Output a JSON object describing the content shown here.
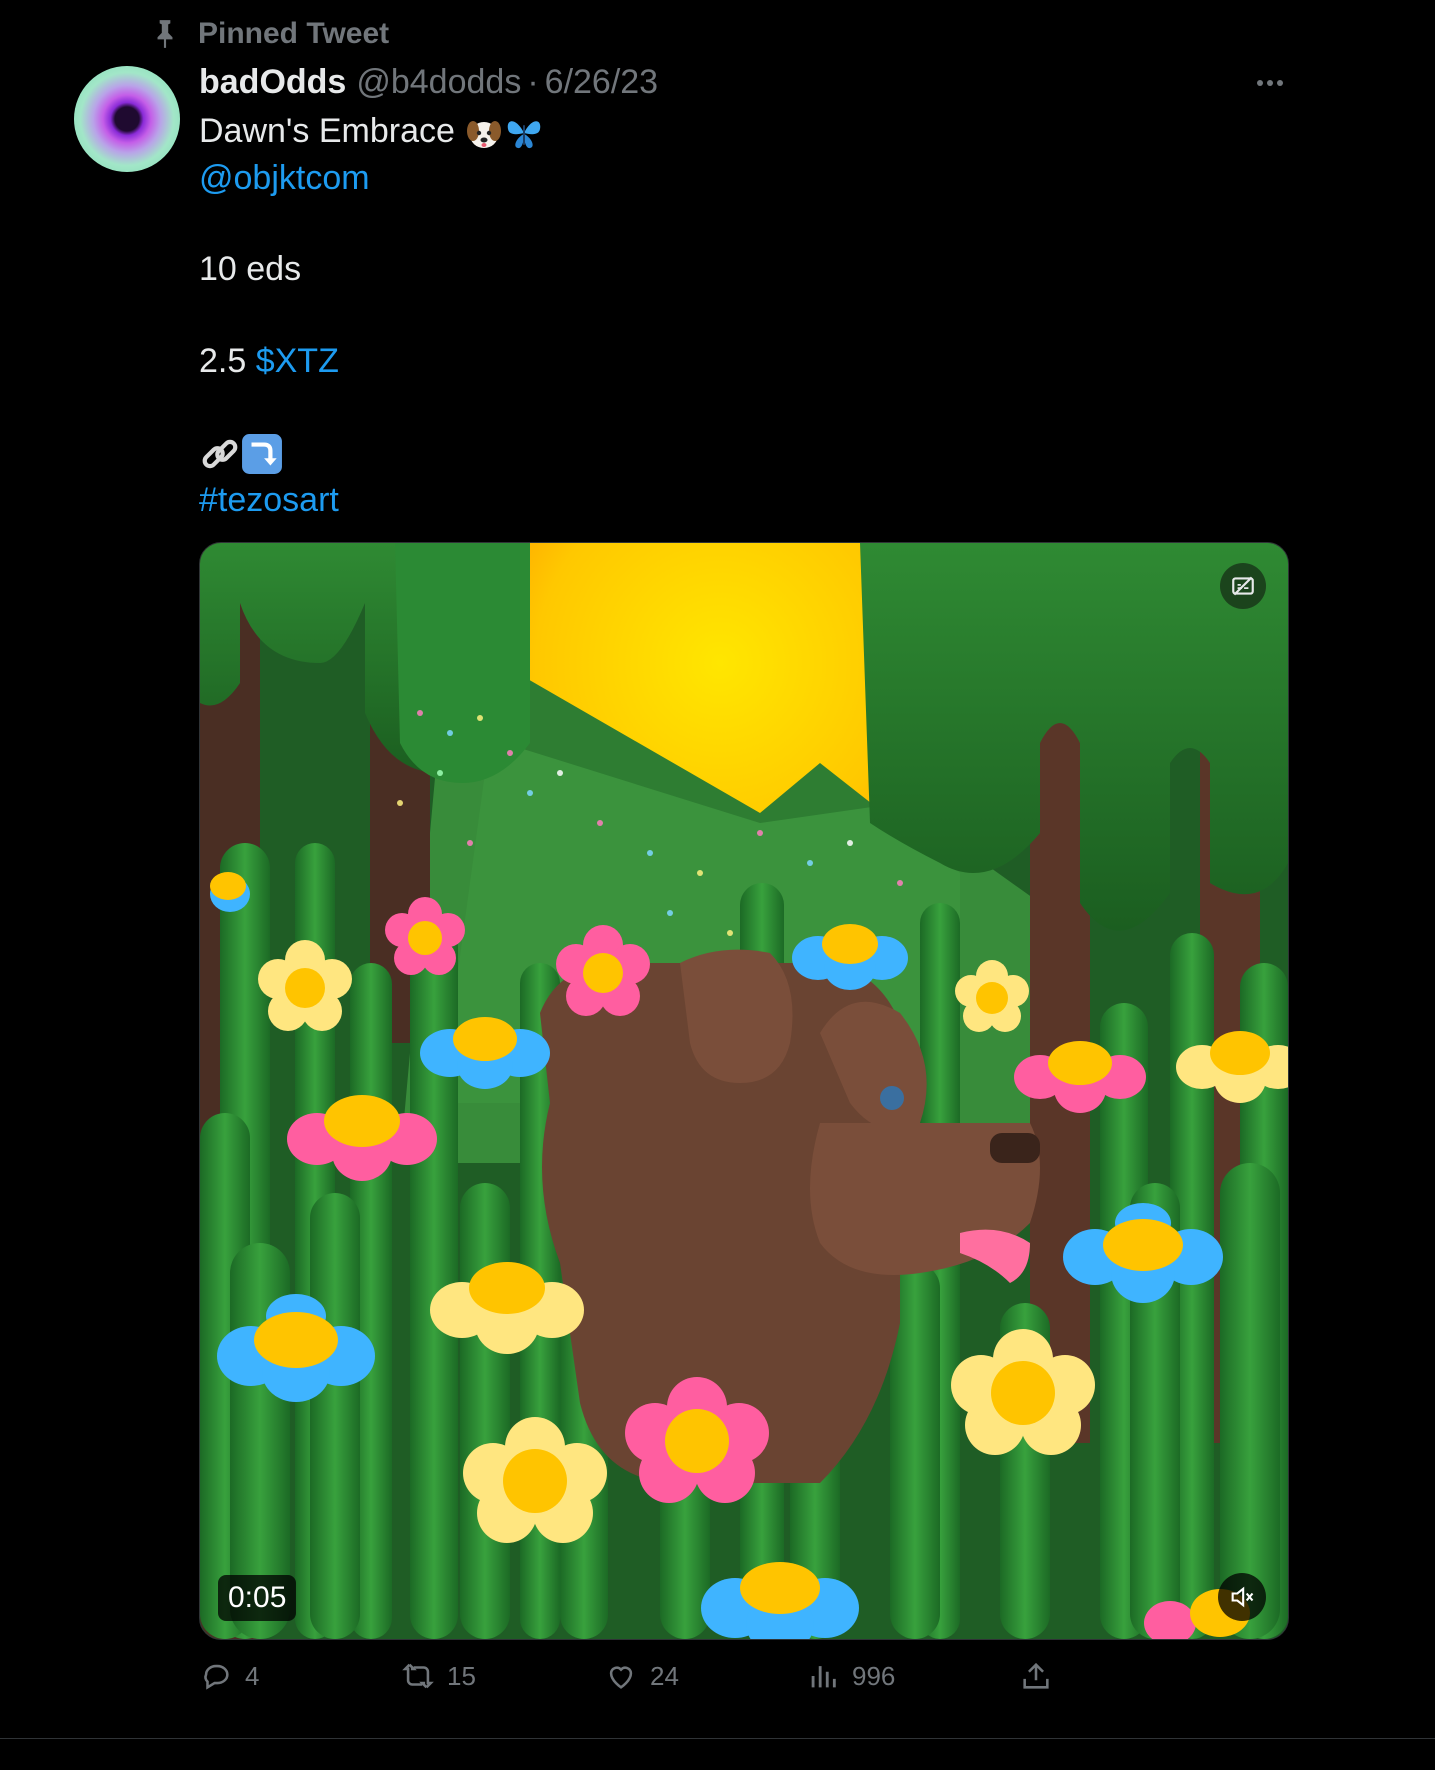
{
  "pinned_label": "Pinned Tweet",
  "author": {
    "name": "badOdds",
    "handle": "@b4dodds",
    "separator": "·",
    "date": "6/26/23"
  },
  "tweet": {
    "title": "Dawn's Embrace",
    "mention": "@objktcom",
    "editions": "10 eds",
    "price_amount": "2.5",
    "price_cashtag": "$XTZ",
    "hashtag": "#tezosart",
    "emojis": [
      "dog-face",
      "butterfly",
      "link",
      "arrow-curving-down"
    ]
  },
  "media": {
    "duration": "0:05",
    "muted": true
  },
  "metrics": {
    "replies": "4",
    "retweets": "15",
    "likes": "24",
    "views": "996"
  },
  "colors": {
    "link": "#1d9bf0",
    "secondary_text": "#71767b",
    "primary_text": "#e7e9ea",
    "background": "#000000"
  }
}
